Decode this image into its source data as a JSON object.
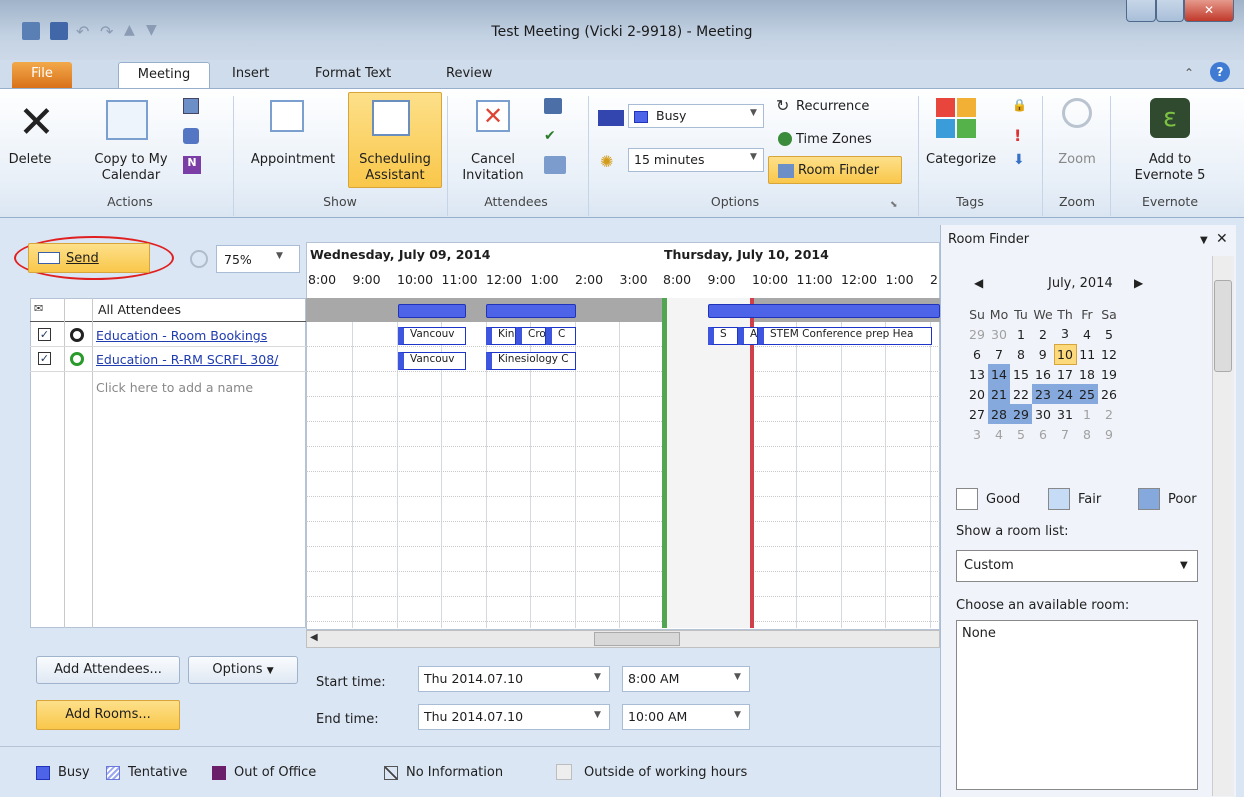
{
  "window": {
    "title": "Test Meeting (Vicki 2-9918)  -  Meeting"
  },
  "tabs": [
    "File",
    "Meeting",
    "Insert",
    "Format Text",
    "Review"
  ],
  "ribbon": {
    "actions": {
      "delete": "Delete",
      "copy": "Copy to My",
      "copy2": "Calendar",
      "group": "Actions"
    },
    "show": {
      "appointment": "Appointment",
      "scheduling": "Scheduling",
      "scheduling2": "Assistant",
      "group": "Show"
    },
    "attendees": {
      "cancel": "Cancel",
      "cancel2": "Invitation",
      "group": "Attendees"
    },
    "options": {
      "show_as": "Busy",
      "reminder": "15 minutes",
      "recurrence": "Recurrence",
      "time_zones": "Time Zones",
      "room_finder": "Room Finder",
      "group": "Options"
    },
    "tags": {
      "categorize": "Categorize",
      "group": "Tags"
    },
    "zoom": {
      "zoom": "Zoom",
      "group": "Zoom"
    },
    "evernote": {
      "add": "Add to",
      "add2": "Evernote 5",
      "group": "Evernote"
    }
  },
  "toolbar": {
    "send": "Send",
    "zoom_value": "75%"
  },
  "schedule": {
    "day1": "Wednesday, July 09, 2014",
    "day2": "Thursday, July 10, 2014",
    "hours1": [
      "8:00",
      "9:00",
      "10:00",
      "11:00",
      "12:00",
      "1:00",
      "2:00",
      "3:00"
    ],
    "hours2": [
      "8:00",
      "9:00",
      "10:00",
      "11:00",
      "12:00",
      "1:00",
      "2"
    ],
    "col_header": "All Attendees",
    "attendees": [
      "Education - Room Bookings",
      "Education - R-RM SCRFL 308/"
    ],
    "add_name": "Click here to add a name",
    "events": [
      "Vancouv",
      "Kines",
      "Cro",
      "C",
      "Vancouv",
      "Kinesiology C",
      "S",
      "A",
      "STEM Conference prep Hea"
    ]
  },
  "bottom": {
    "add_attendees": "Add Attendees...",
    "options": "Options",
    "add_rooms": "Add Rooms...",
    "start_label": "Start time:",
    "end_label": "End time:",
    "start_date": "Thu 2014.07.10",
    "start_time": "8:00 AM",
    "end_date": "Thu 2014.07.10",
    "end_time": "10:00 AM"
  },
  "legend": {
    "busy": "Busy",
    "tentative": "Tentative",
    "ooo": "Out of Office",
    "noinfo": "No Information",
    "outside": "Outside of working hours"
  },
  "room_finder": {
    "title": "Room Finder",
    "month": "July, 2014",
    "days": [
      "Su",
      "Mo",
      "Tu",
      "We",
      "Th",
      "Fr",
      "Sa"
    ],
    "weeks": [
      [
        "29",
        "30",
        "1",
        "2",
        "3",
        "4",
        "5"
      ],
      [
        "6",
        "7",
        "8",
        "9",
        "10",
        "11",
        "12"
      ],
      [
        "13",
        "14",
        "15",
        "16",
        "17",
        "18",
        "19"
      ],
      [
        "20",
        "21",
        "22",
        "23",
        "24",
        "25",
        "26"
      ],
      [
        "27",
        "28",
        "29",
        "30",
        "31",
        "1",
        "2"
      ],
      [
        "3",
        "4",
        "5",
        "6",
        "7",
        "8",
        "9"
      ]
    ],
    "good": "Good",
    "fair": "Fair",
    "poor": "Poor",
    "room_list_label": "Show a room list:",
    "room_list_value": "Custom",
    "choose_label": "Choose an available room:",
    "room_value": "None"
  }
}
